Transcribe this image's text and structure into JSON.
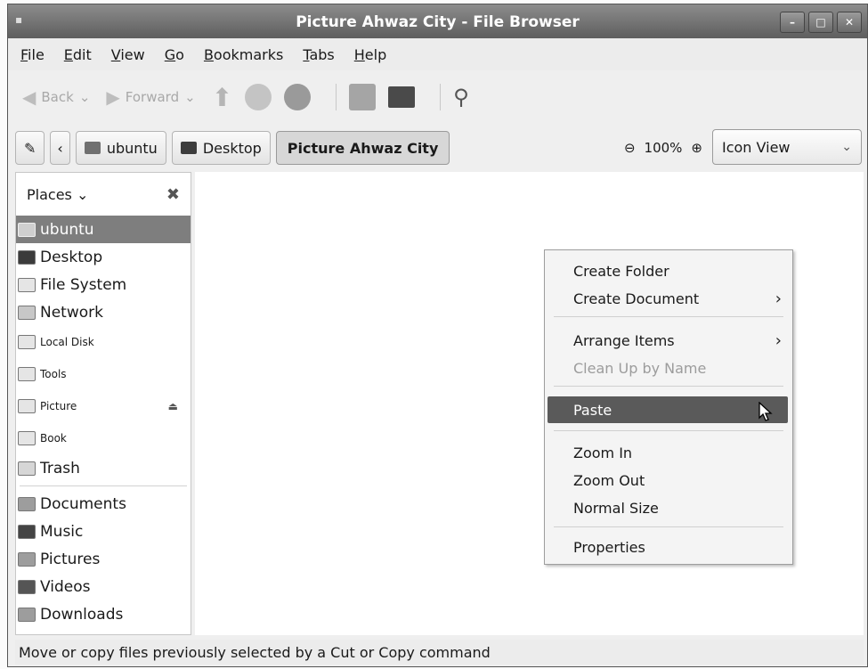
{
  "window": {
    "title": "Picture Ahwaz City - File Browser",
    "controls": [
      "–",
      "□",
      "✕"
    ]
  },
  "menubar": [
    "File",
    "Edit",
    "View",
    "Go",
    "Bookmarks",
    "Tabs",
    "Help"
  ],
  "toolbar": {
    "back_label": "Back",
    "forward_label": "Forward"
  },
  "location": {
    "crumbs": [
      "ubuntu",
      "Desktop",
      "Picture Ahwaz City"
    ],
    "zoom_level": "100%",
    "view_mode": "Icon View"
  },
  "sidebar": {
    "header": "Places",
    "places": [
      "ubuntu",
      "Desktop",
      "File System",
      "Network",
      "Local Disk",
      "Tools",
      "Picture",
      "Book",
      "Trash"
    ],
    "bookmarks": [
      "Documents",
      "Music",
      "Pictures",
      "Videos",
      "Downloads"
    ],
    "selected": "ubuntu"
  },
  "context_menu": {
    "items": [
      {
        "label": "Create Folder",
        "state": "normal"
      },
      {
        "label": "Create Document",
        "state": "submenu"
      },
      {
        "label": "Arrange Items",
        "state": "submenu"
      },
      {
        "label": "Clean Up by Name",
        "state": "disabled"
      },
      {
        "label": "Paste",
        "state": "highlighted"
      },
      {
        "label": "Zoom In",
        "state": "normal"
      },
      {
        "label": "Zoom Out",
        "state": "normal"
      },
      {
        "label": "Normal Size",
        "state": "normal"
      },
      {
        "label": "Properties",
        "state": "normal"
      }
    ]
  },
  "status": "Move or copy files previously selected by a Cut or Copy command"
}
